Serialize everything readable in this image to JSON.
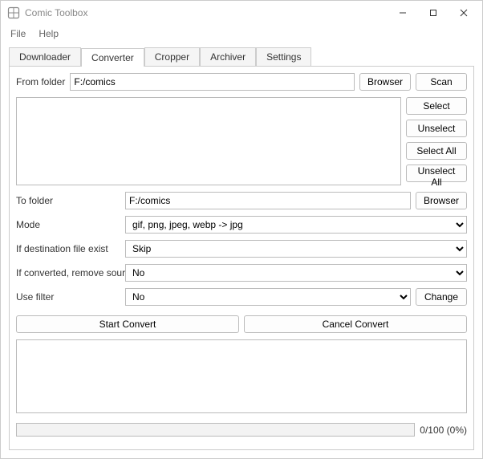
{
  "window": {
    "title": "Comic Toolbox"
  },
  "menu": {
    "file": "File",
    "help": "Help"
  },
  "tabs": {
    "downloader": "Downloader",
    "converter": "Converter",
    "cropper": "Cropper",
    "archiver": "Archiver",
    "settings": "Settings"
  },
  "labels": {
    "from_folder": "From folder",
    "to_folder": "To folder",
    "mode": "Mode",
    "if_dest": "If destination file exist",
    "if_converted": "If converted, remove source",
    "use_filter": "Use filter"
  },
  "values": {
    "from_folder": "F:/comics",
    "to_folder": "F:/comics",
    "mode": "gif, png, jpeg, webp -> jpg",
    "if_dest": "Skip",
    "if_converted": "No",
    "use_filter": "No"
  },
  "buttons": {
    "browser": "Browser",
    "scan": "Scan",
    "select": "Select",
    "unselect": "Unselect",
    "select_all": "Select All",
    "unselect_all": "Unselect All",
    "change": "Change",
    "start": "Start Convert",
    "cancel": "Cancel Convert"
  },
  "progress": {
    "text": "0/100 (0%)"
  }
}
